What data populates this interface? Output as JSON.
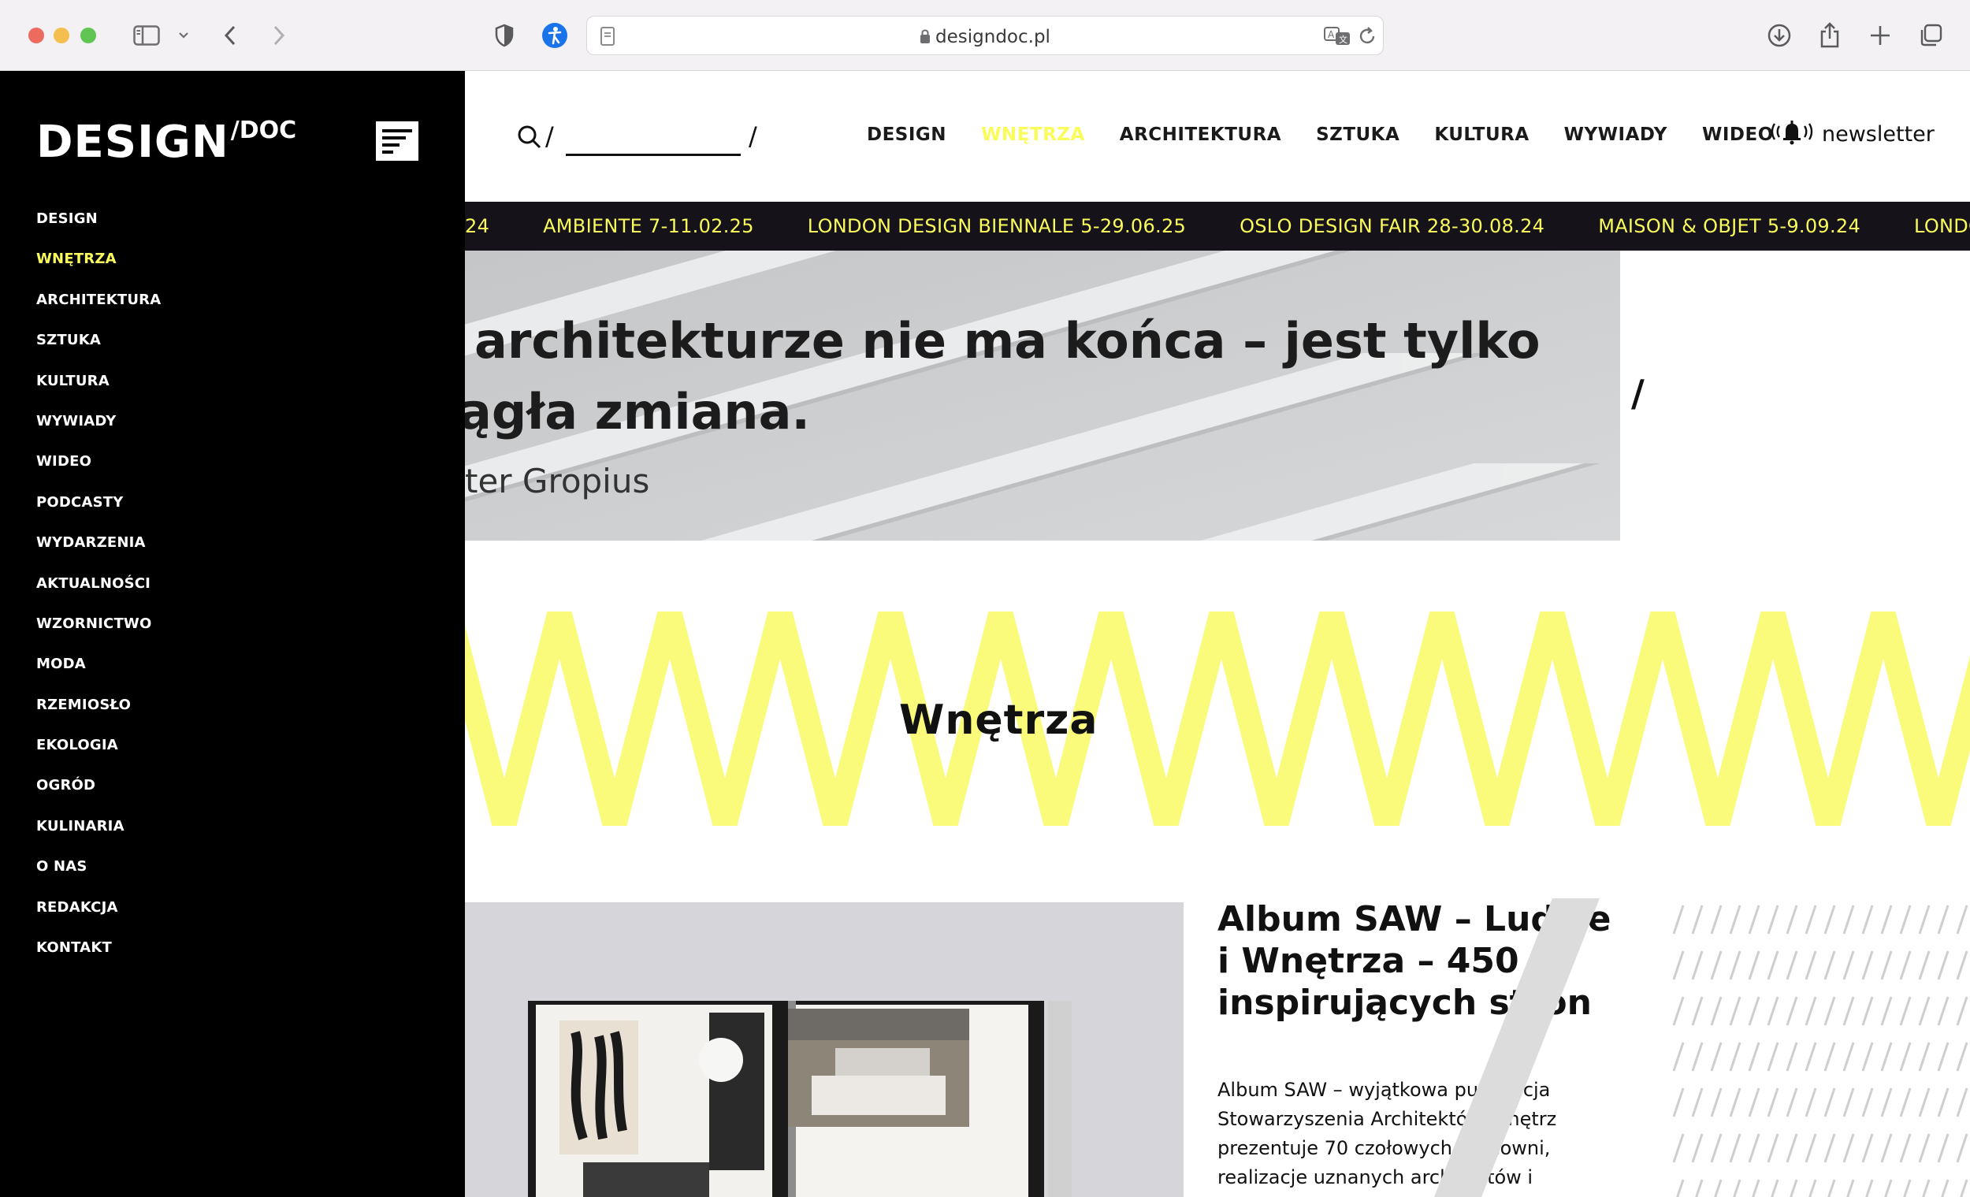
{
  "browser": {
    "url": "designdoc.pl"
  },
  "logo": {
    "main": "DESIGN",
    "sup": "/DOC"
  },
  "sidebar": {
    "items": [
      {
        "label": "DESIGN"
      },
      {
        "label": "WNĘTRZA",
        "active": true
      },
      {
        "label": "ARCHITEKTURA"
      },
      {
        "label": "SZTUKA"
      },
      {
        "label": "KULTURA"
      },
      {
        "label": "WYWIADY"
      },
      {
        "label": "WIDEO"
      },
      {
        "label": "PODCASTY"
      },
      {
        "label": "WYDARZENIA"
      },
      {
        "label": "AKTUALNOŚCI"
      },
      {
        "label": "WZORNICTWO"
      },
      {
        "label": "MODA"
      },
      {
        "label": "RZEMIOSŁO"
      },
      {
        "label": "EKOLOGIA"
      },
      {
        "label": "OGRÓD"
      },
      {
        "label": "KULINARIA"
      },
      {
        "label": "O NAS"
      },
      {
        "label": "REDAKCJA"
      },
      {
        "label": "KONTAKT"
      }
    ]
  },
  "header": {
    "search_slash": "/",
    "search_end_slash": "/",
    "nav": [
      {
        "label": "DESIGN"
      },
      {
        "label": "WNĘTRZA",
        "active": true
      },
      {
        "label": "ARCHITEKTURA"
      },
      {
        "label": "SZTUKA"
      },
      {
        "label": "KULTURA"
      },
      {
        "label": "WYWIADY"
      },
      {
        "label": "WIDEO"
      }
    ],
    "newsletter": "newsletter"
  },
  "ticker": {
    "items": [
      "24",
      "AMBIENTE 7-11.02.25",
      "LONDON DESIGN BIENNALE 5-29.06.25",
      "OSLO DESIGN FAIR 28-30.08.24",
      "MAISON & OBJET 5-9.09.24",
      "LONDON I"
    ]
  },
  "hero": {
    "line1": "architekturze nie ma końca – jest tylko",
    "line2": "ągła zmiana.",
    "author": "ter Gropius",
    "side_slash": "/"
  },
  "section": {
    "title": "Wnętrza"
  },
  "article": {
    "title": "Album SAW – Ludzie i Wnętrza – 450 inspirujących stron",
    "excerpt": "Album SAW – wyjątkowa publikacja Stowarzyszenia Architektów Wnętrz prezentuje 70 czołowych pracowni, realizacje uznanych architektów i"
  },
  "colors": {
    "accent": "#f9fc5a",
    "zigzag": "#fafb7a",
    "sidebar_bg": "#000000",
    "ticker_bg": "#15121a"
  }
}
